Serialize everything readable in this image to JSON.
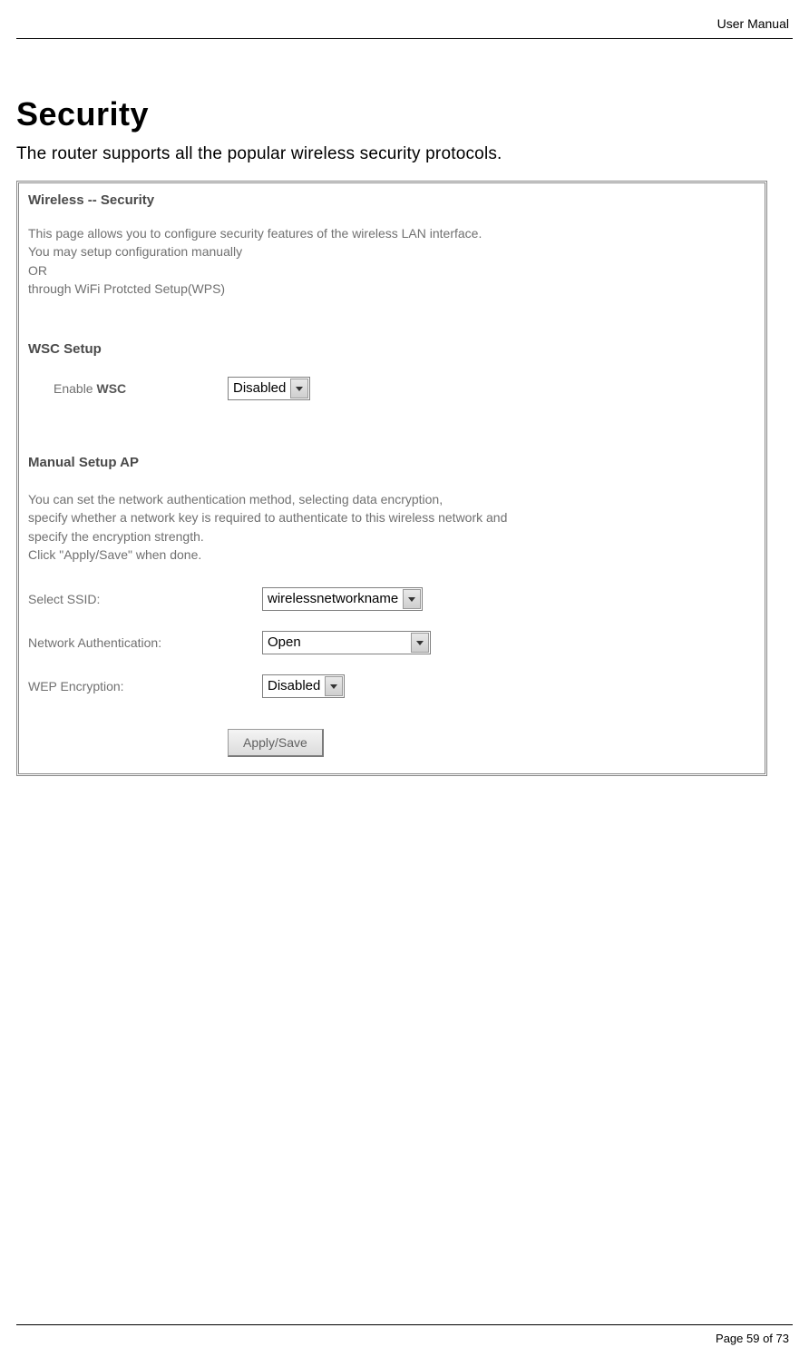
{
  "doc": {
    "header_label": "User Manual",
    "heading": "Security",
    "intro": "The router supports all the popular wireless security protocols.",
    "footer": "Page 59 of 73"
  },
  "panel": {
    "title": "Wireless -- Security",
    "intro_text": "This page allows you to configure security features of the wireless LAN interface.\nYou may setup configuration manually\n         OR\nthrough WiFi Protcted Setup(WPS)",
    "wsc": {
      "section_title": "WSC Setup",
      "label_prefix": "Enable ",
      "label_strong": "WSC",
      "value": "Disabled"
    },
    "manual": {
      "section_title": "Manual Setup AP",
      "description": "You can set the network authentication method, selecting data encryption,\nspecify whether a network key is required to authenticate to this wireless network and\nspecify the encryption strength.\nClick \"Apply/Save\" when done.",
      "ssid_label": "Select SSID:",
      "ssid_value": "wirelessnetworkname",
      "auth_label": "Network Authentication:",
      "auth_value": "Open",
      "wep_label": "WEP Encryption:",
      "wep_value": "Disabled",
      "apply_button": "Apply/Save"
    }
  }
}
